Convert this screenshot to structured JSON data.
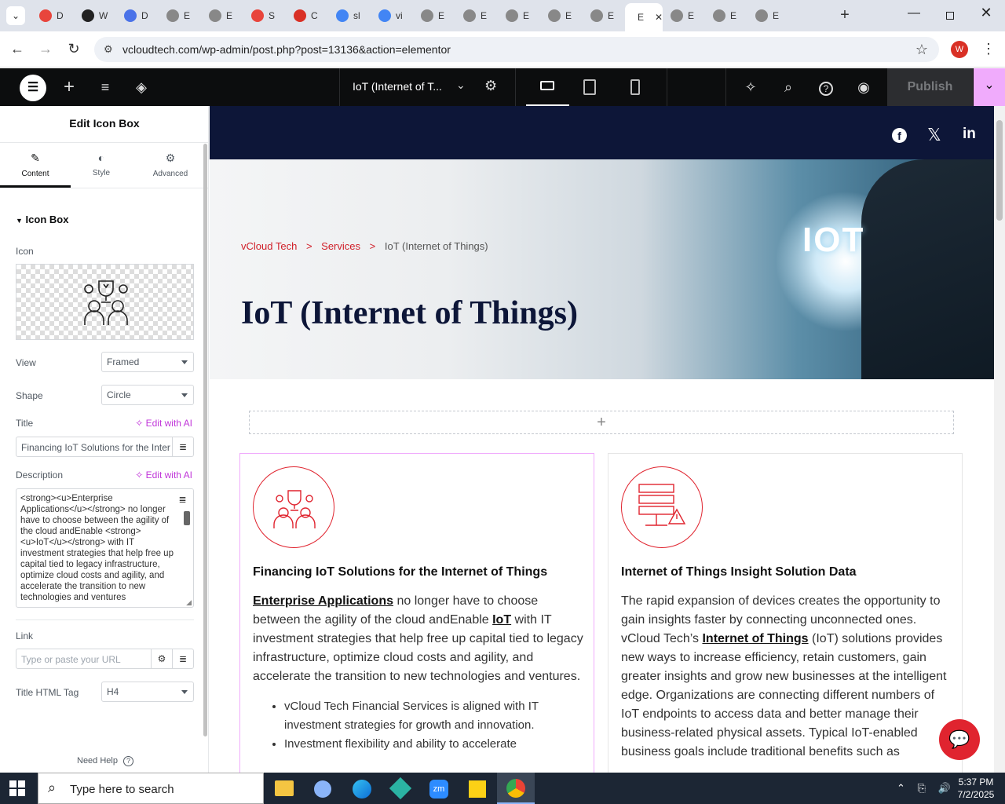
{
  "browser": {
    "tabs": [
      "D",
      "W",
      "D",
      "E",
      "E",
      "S",
      "C",
      "sl",
      "vi",
      "E",
      "E",
      "E",
      "E",
      "E",
      "E",
      "E",
      "E",
      "E"
    ],
    "active_tab": "E",
    "url": "vcloudtech.com/wp-admin/post.php?post=13136&action=elementor",
    "profile_initial": "W"
  },
  "editor_top": {
    "page_title": "IoT (Internet of T...",
    "publish_label": "Publish"
  },
  "panel": {
    "title": "Edit Icon Box",
    "tabs": [
      "Content",
      "Style",
      "Advanced"
    ],
    "section": "Icon Box",
    "icon_label": "Icon",
    "view_label": "View",
    "view_value": "Framed",
    "shape_label": "Shape",
    "shape_value": "Circle",
    "title_label": "Title",
    "edit_ai": "Edit with AI",
    "title_value": "Financing IoT Solutions for the Inter",
    "description_label": "Description",
    "description_value": "<strong><u>Enterprise Applications</u></strong> no longer have to choose between the agility of the cloud andEnable <strong><u>IoT</u></strong> with IT investment strategies that help free up capital tied to legacy infrastructure, optimize cloud costs and agility, and accelerate the transition to new technologies and ventures",
    "link_label": "Link",
    "link_placeholder": "Type or paste your URL",
    "html_tag_label": "Title HTML Tag",
    "html_tag_value": "H4",
    "need_help": "Need Help"
  },
  "page": {
    "breadcrumb": [
      "vCloud Tech",
      ">",
      "Services",
      ">",
      "IoT (Internet of Things)"
    ],
    "hero_title": "IoT (Internet of Things)",
    "hero_badge": "IOT",
    "card1": {
      "title": "Financing IoT Solutions for the Internet of Things",
      "desc_link1": "Enterprise Applications",
      "desc_part1": " no longer have to choose between the agility of the cloud andEnable ",
      "desc_link2": "IoT",
      "desc_part2": " with IT investment strategies that help free up capital tied to legacy infrastructure, optimize cloud costs and agility, and accelerate the transition to new technologies and ventures.",
      "bullets": [
        "vCloud Tech Financial Services is aligned with IT investment strategies for growth and innovation.",
        "Investment flexibility and ability to accelerate"
      ]
    },
    "card2": {
      "title": "Internet of Things Insight Solution Data",
      "desc_part1": "The rapid expansion of devices creates the opportunity to gain insights faster by connecting unconnected ones. vCloud Tech’s ",
      "desc_link": "Internet of Things",
      "desc_part2": " (IoT) solutions provides new ways to increase efficiency, retain customers, gain greater insights and grow new businesses at the intelligent edge. Organizations are connecting different numbers of IoT endpoints to access data and better manage their business-related physical assets. Typical IoT-enabled business goals include traditional benefits such as"
    }
  },
  "taskbar": {
    "search_placeholder": "Type here to search",
    "time": "5:37 PM",
    "date": "7/2/2025"
  },
  "colors": {
    "accent_red": "#e0242f",
    "navy": "#0d1638",
    "elementor_pink": "#f0abfc",
    "ai_purple": "#c036d9"
  }
}
